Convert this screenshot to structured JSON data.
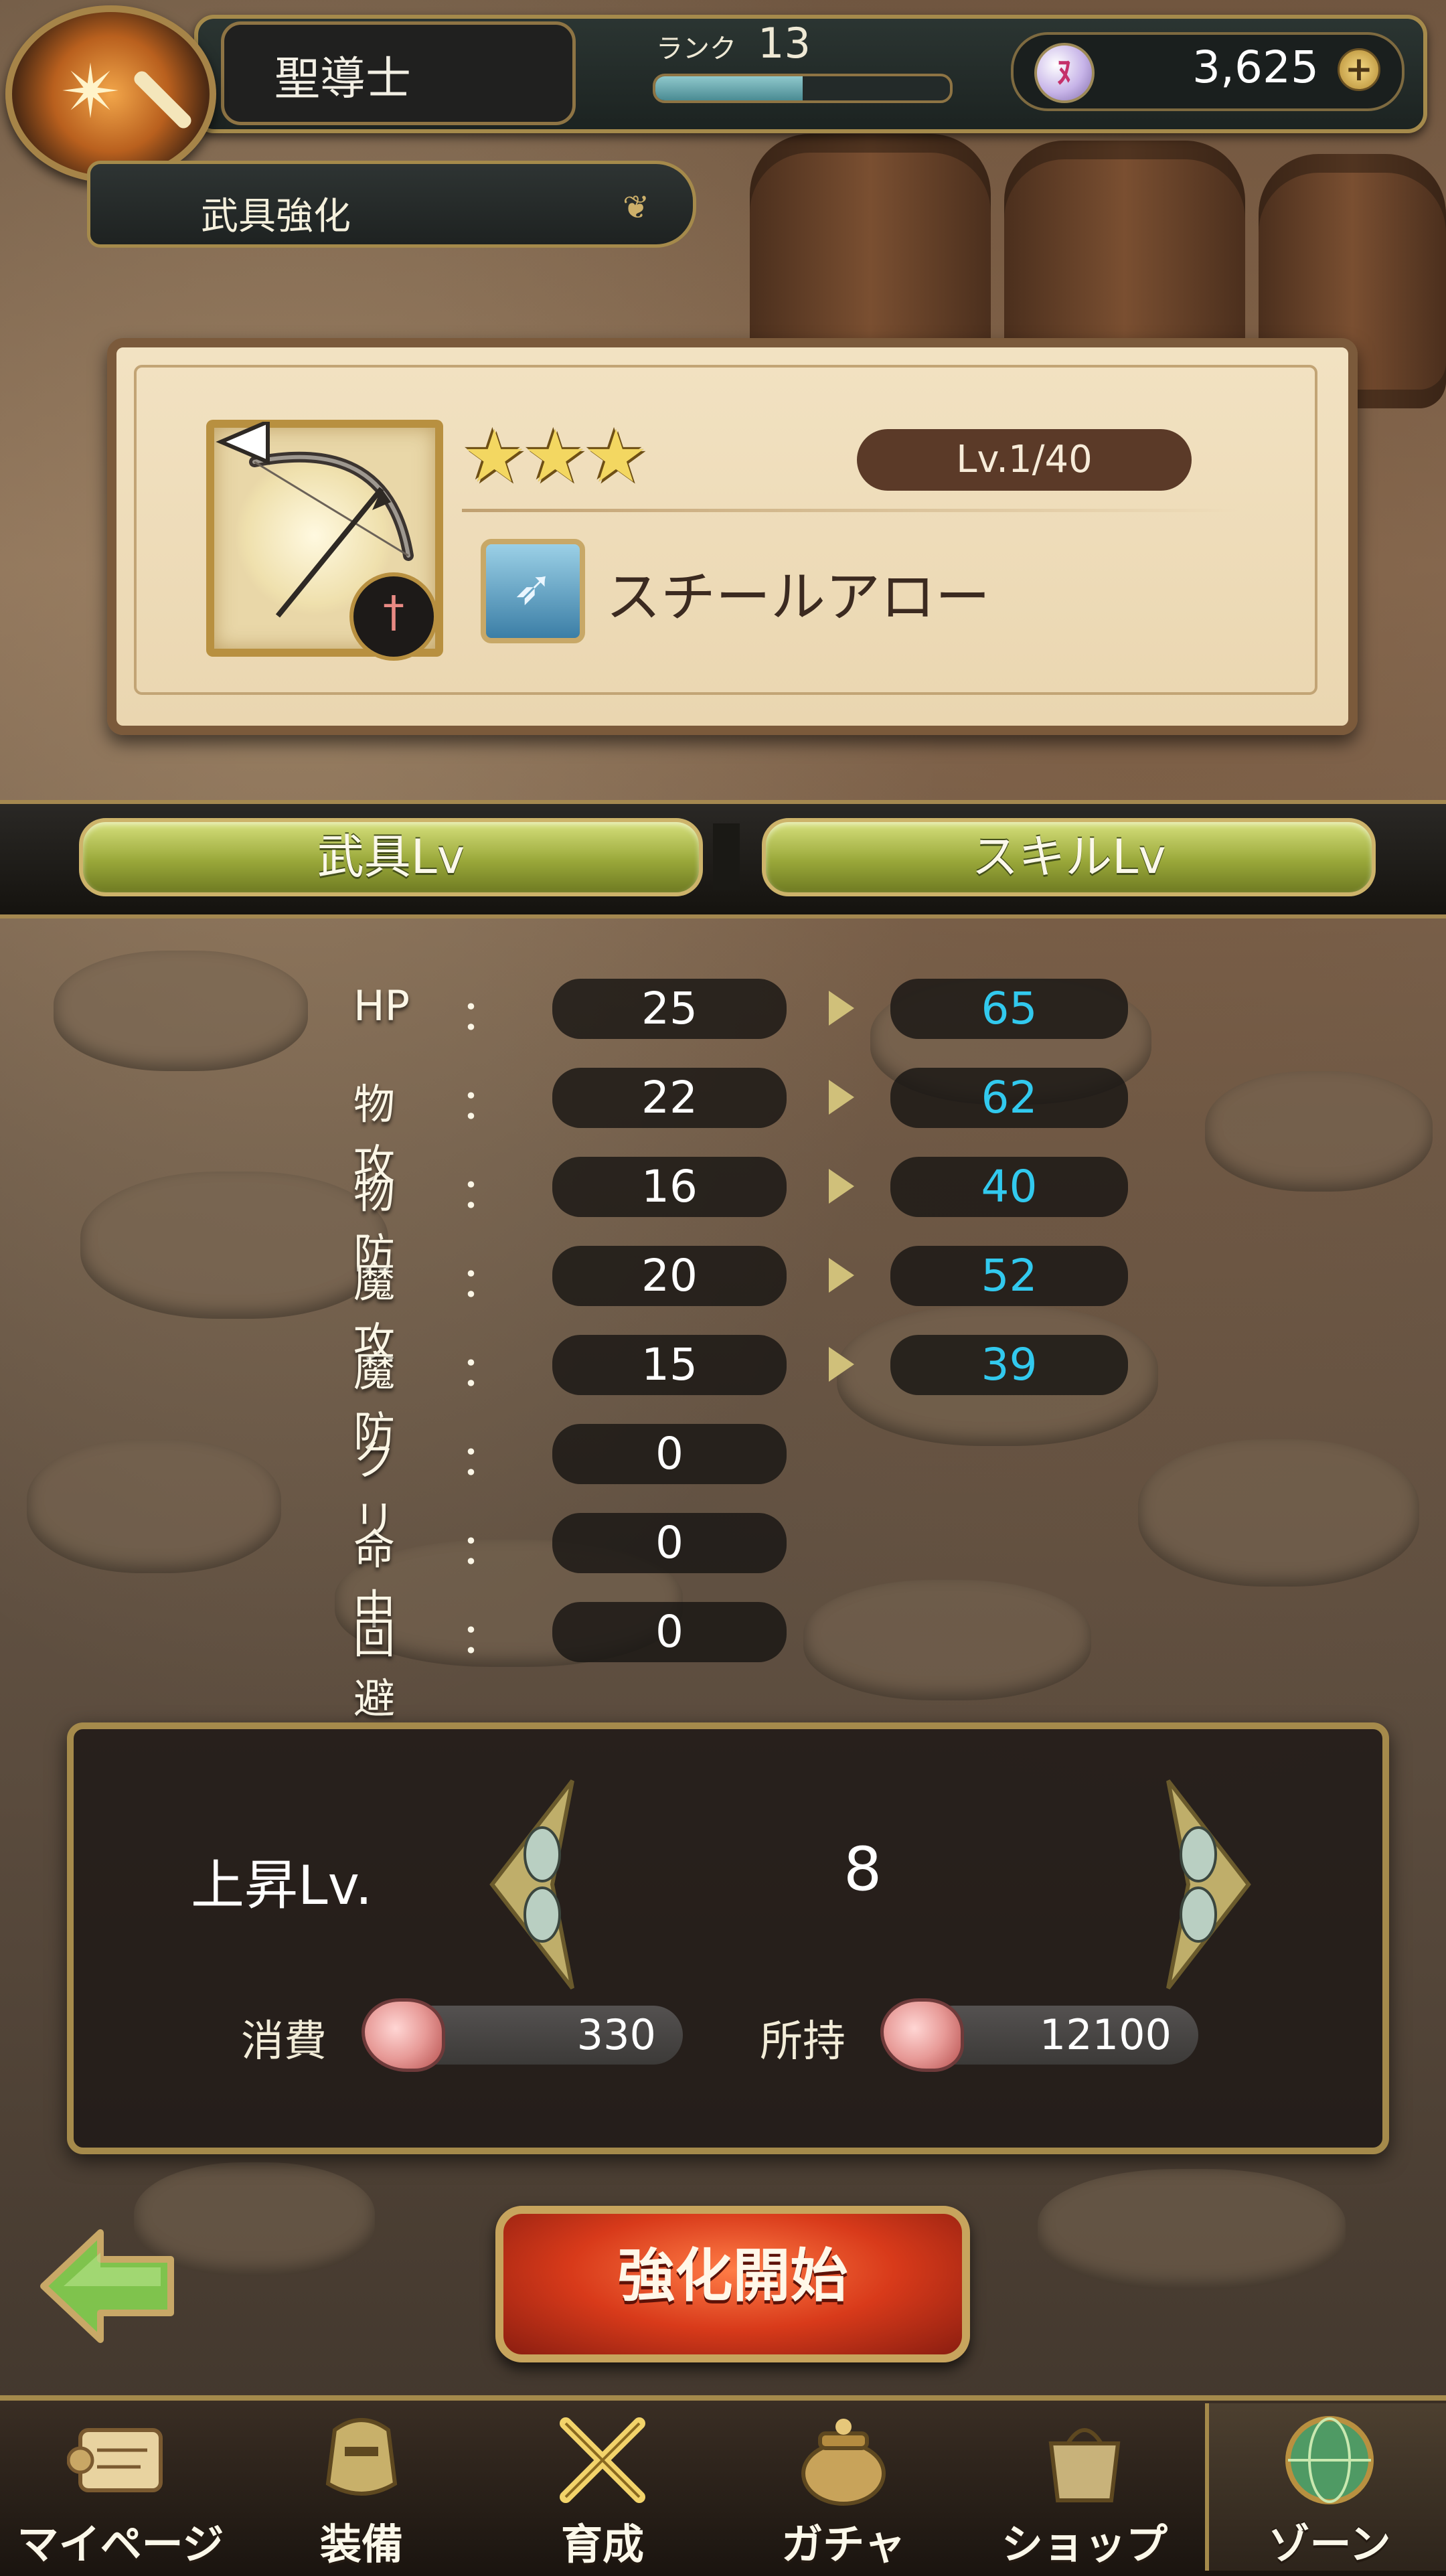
{
  "header": {
    "class_name": "聖導士",
    "rank_label": "ランク",
    "rank_value": "13",
    "rank_progress": 0.5,
    "gem_count": "3,625",
    "gem_icon": "gem-icon",
    "plus_icon": "plus-icon"
  },
  "screen_title": "武具強化",
  "weapon": {
    "stars": "★★★",
    "level": "Lv.1/40",
    "name": "スチールアロー",
    "type_icon": "bow-icon",
    "element_icon": "sword-icon"
  },
  "tabs": [
    {
      "label": "武具Lv",
      "active": true
    },
    {
      "label": "スキルLv",
      "active": false
    }
  ],
  "stats": [
    {
      "label": "HP",
      "colon": "：",
      "current": "25",
      "next": "65"
    },
    {
      "label": "物攻",
      "colon": "：",
      "current": "22",
      "next": "62"
    },
    {
      "label": "物防",
      "colon": "：",
      "current": "16",
      "next": "40"
    },
    {
      "label": "魔攻",
      "colon": "：",
      "current": "20",
      "next": "52"
    },
    {
      "label": "魔防",
      "colon": "：",
      "current": "15",
      "next": "39"
    },
    {
      "label": "クリ",
      "colon": "：",
      "current": "0",
      "next": ""
    },
    {
      "label": "命中",
      "colon": "：",
      "current": "0",
      "next": ""
    },
    {
      "label": "回避",
      "colon": "：",
      "current": "0",
      "next": ""
    }
  ],
  "levelup": {
    "label": "上昇Lv.",
    "value": "8",
    "consume_label": "消費",
    "consume_value": "330",
    "owned_label": "所持",
    "owned_value": "12100",
    "material_icon": "meat-icon"
  },
  "start_button": "強化開始",
  "back_icon": "back-arrow-icon",
  "nav": [
    {
      "label": "マイページ",
      "icon": "scroll-icon"
    },
    {
      "label": "装備",
      "icon": "armor-icon"
    },
    {
      "label": "育成",
      "icon": "swords-icon"
    },
    {
      "label": "ガチャ",
      "icon": "pot-icon"
    },
    {
      "label": "ショップ",
      "icon": "bag-icon"
    },
    {
      "label": "ゾーン",
      "icon": "globe-icon"
    }
  ],
  "colors": {
    "accent_gold": "#a58a4b",
    "stat_new": "#32c9ee",
    "start_red": "#d83a1a"
  }
}
